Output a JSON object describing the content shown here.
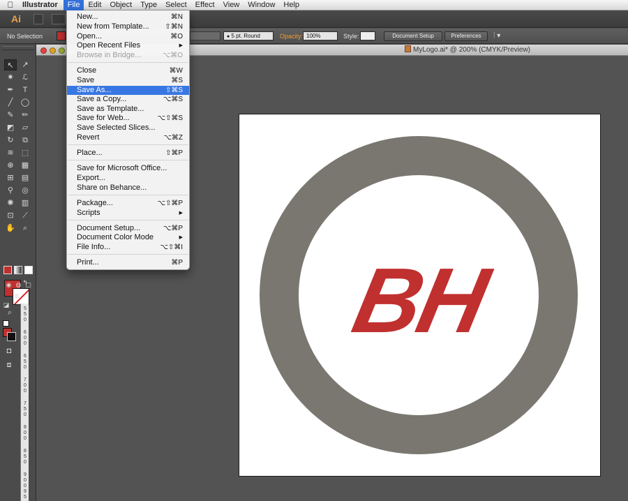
{
  "menubar": {
    "app_name": "Illustrator",
    "items": [
      "File",
      "Edit",
      "Object",
      "Type",
      "Select",
      "Effect",
      "View",
      "Window",
      "Help"
    ],
    "active_item": "File"
  },
  "appbar": {
    "logo_text": "Ai"
  },
  "controlbar": {
    "selection_label": "No Selection",
    "brush_value": "5 pt. Round",
    "opacity_label": "Opacity:",
    "opacity_value": "100%",
    "style_label": "Style:",
    "document_setup_label": "Document Setup",
    "preferences_label": "Preferences"
  },
  "document": {
    "title": "MyLogo.ai* @ 200% (CMYK/Preview)"
  },
  "ruler": {
    "ticks": [
      "5",
      "5",
      "0",
      "6",
      "0",
      "0",
      "6",
      "5",
      "0",
      "7",
      "0",
      "0",
      "7",
      "5",
      "0",
      "8",
      "0",
      "0",
      "8",
      "5",
      "0",
      "9",
      "0",
      "0",
      "9",
      "5",
      "0"
    ]
  },
  "file_menu": {
    "items": [
      {
        "label": "New...",
        "shortcut": "⌘N"
      },
      {
        "label": "New from Template...",
        "shortcut": "⇧⌘N"
      },
      {
        "label": "Open...",
        "shortcut": "⌘O"
      },
      {
        "label": "Open Recent Files",
        "shortcut": "▶"
      },
      {
        "label": "Browse in Bridge...",
        "shortcut": "⌥⌘O"
      },
      {
        "label": "Close",
        "shortcut": "⌘W"
      },
      {
        "label": "Save",
        "shortcut": "⌘S"
      },
      {
        "label": "Save As...",
        "shortcut": "⇧⌘S"
      },
      {
        "label": "Save a Copy...",
        "shortcut": "⌥⌘S"
      },
      {
        "label": "Save as Template...",
        "shortcut": ""
      },
      {
        "label": "Save for Web...",
        "shortcut": "⌥⇧⌘S"
      },
      {
        "label": "Save Selected Slices...",
        "shortcut": ""
      },
      {
        "label": "Revert",
        "shortcut": "⌥⌘Z"
      },
      {
        "label": "Place...",
        "shortcut": "⇧⌘P"
      },
      {
        "label": "Save for Microsoft Office...",
        "shortcut": ""
      },
      {
        "label": "Export...",
        "shortcut": ""
      },
      {
        "label": "Share on Behance...",
        "shortcut": ""
      },
      {
        "label": "Package...",
        "shortcut": "⌥⇧⌘P"
      },
      {
        "label": "Scripts",
        "shortcut": "▶"
      },
      {
        "label": "Document Setup...",
        "shortcut": "⌥⌘P"
      },
      {
        "label": "Document Color Mode",
        "shortcut": "▶"
      },
      {
        "label": "File Info...",
        "shortcut": "⌥⇧⌘I"
      },
      {
        "label": "Print...",
        "shortcut": "⌘P"
      }
    ],
    "highlighted_item": "Save As...",
    "disabled_item": "Browse in Bridge..."
  },
  "artwork": {
    "logo_text": "BH",
    "ring_color": "#797770",
    "logo_color": "#c0302f"
  },
  "colors": {
    "accent": "#3877e3",
    "fill_color": "#c0302f"
  }
}
